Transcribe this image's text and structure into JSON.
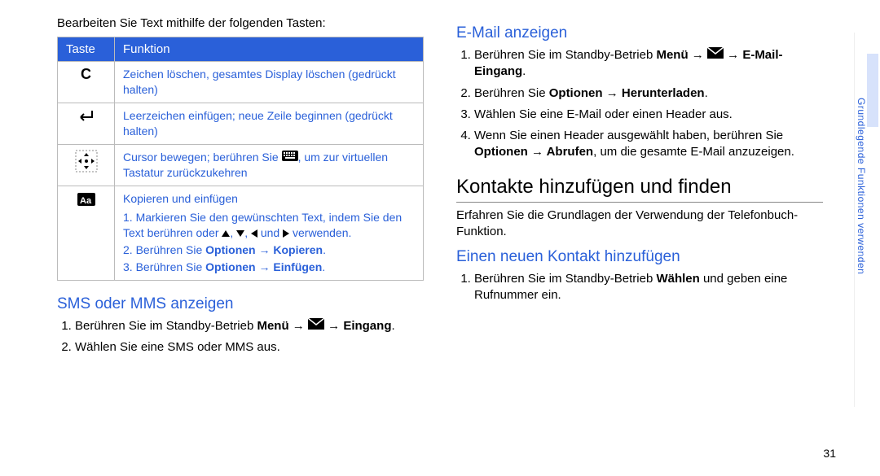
{
  "intro": "Bearbeiten Sie Text mithilfe der folgenden Tasten:",
  "table": {
    "head_key": "Taste",
    "head_func": "Funktion",
    "rows": [
      {
        "icon": "c-key",
        "func_html": "Zeichen löschen, gesamtes Display löschen (gedrückt halten)"
      },
      {
        "icon": "enter-key",
        "func_html": "Leerzeichen einfügen; neue Zeile beginnen (gedrückt halten)"
      },
      {
        "icon": "dpad-key",
        "func_html_cursor": "Cursor bewegen; berühren Sie ",
        "func_html_cursor2": ", um zur virtuellen Tastatur zurückzukehren"
      },
      {
        "icon": "aa-key",
        "copy_title": "Kopieren und einfügen",
        "step1a": "1. Markieren Sie den gewünschten Text, indem Sie den Text berühren oder ",
        "step1b": " und ",
        "step1c": " verwenden.",
        "step2": "2. Berühren Sie ",
        "step2_bold": "Optionen → Kopieren",
        "step3": "3. Berühren Sie ",
        "step3_bold": "Optionen → Einfügen"
      }
    ]
  },
  "sms": {
    "heading": "SMS oder MMS anzeigen",
    "item1a": "Berühren Sie im Standby-Betrieb ",
    "item1_bold1": "Menü",
    "item1_arrow": " → ",
    "item1_bold2": "Eingang",
    "item2": "Wählen Sie eine SMS oder MMS aus."
  },
  "email": {
    "heading": "E-Mail anzeigen",
    "item1a": "Berühren Sie im Standby-Betrieb ",
    "item1_bold1": "Menü",
    "item1_arrow": " → ",
    "item1_bold2": "E-Mail-Eingang",
    "item2a": "Berühren Sie ",
    "item2_bold": "Optionen → Herunterladen",
    "item3": "Wählen Sie eine E-Mail oder einen Header aus.",
    "item4a": "Wenn Sie einen Header ausgewählt haben, berühren Sie ",
    "item4_bold": "Optionen → Abrufen",
    "item4b": ", um die gesamte E-Mail anzuzeigen."
  },
  "contacts": {
    "heading": "Kontakte hinzufügen und finden",
    "intro": "Erfahren Sie die Grundlagen der Verwendung der Telefonbuch-Funktion.",
    "sub": "Einen neuen Kontakt hinzufügen",
    "item1a": "Berühren Sie im Standby-Betrieb ",
    "item1_bold": "Wählen",
    "item1b": " und geben eine Rufnummer ein."
  },
  "side_label": "Grundlegende Funktionen verwenden",
  "page_number": "31",
  "dot": ".",
  "comma": ", "
}
